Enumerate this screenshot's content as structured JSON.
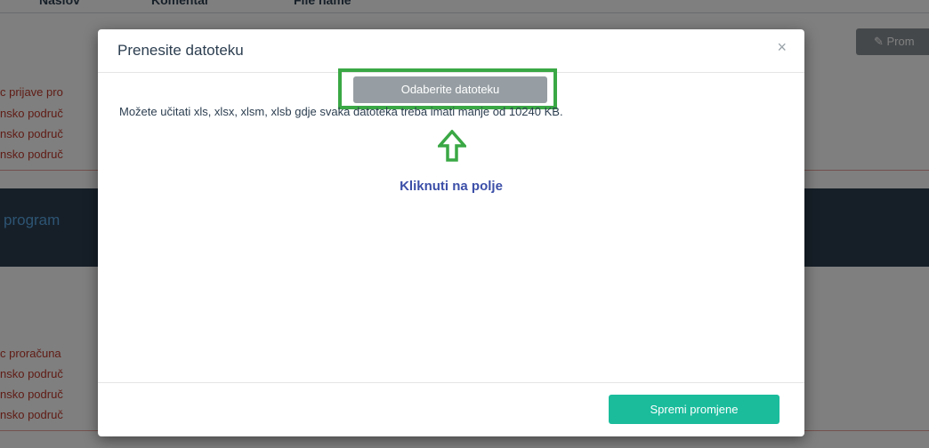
{
  "background": {
    "columns": [
      "Naslov",
      "Komentar",
      "File name"
    ],
    "edit_button": "✎ Prom",
    "red_items_top": [
      "c prijave pro",
      "nsko područ",
      "nsko područ",
      "nsko područ"
    ],
    "dark_band_text": "program",
    "red_items_bottom": [
      "c proračuna",
      "nsko područ",
      "nsko područ",
      "nsko područ"
    ]
  },
  "modal": {
    "title": "Prenesite datoteku",
    "close_symbol": "×",
    "choose_button": "Odaberite datoteku",
    "info_text": "Možete učitati xls, xlsx, xlsm, xlsb gdje svaka datoteka treba imati manje od 10240 KB.",
    "annotation": "Kliknuti na polje",
    "save_button": "Spremi promjene"
  },
  "colors": {
    "highlight": "#3aa845",
    "save_button": "#1abc9c",
    "annotation": "#3c4fa8"
  },
  "icons": {
    "annotation_arrow": "arrow-up-outline-icon",
    "close": "close-icon"
  }
}
